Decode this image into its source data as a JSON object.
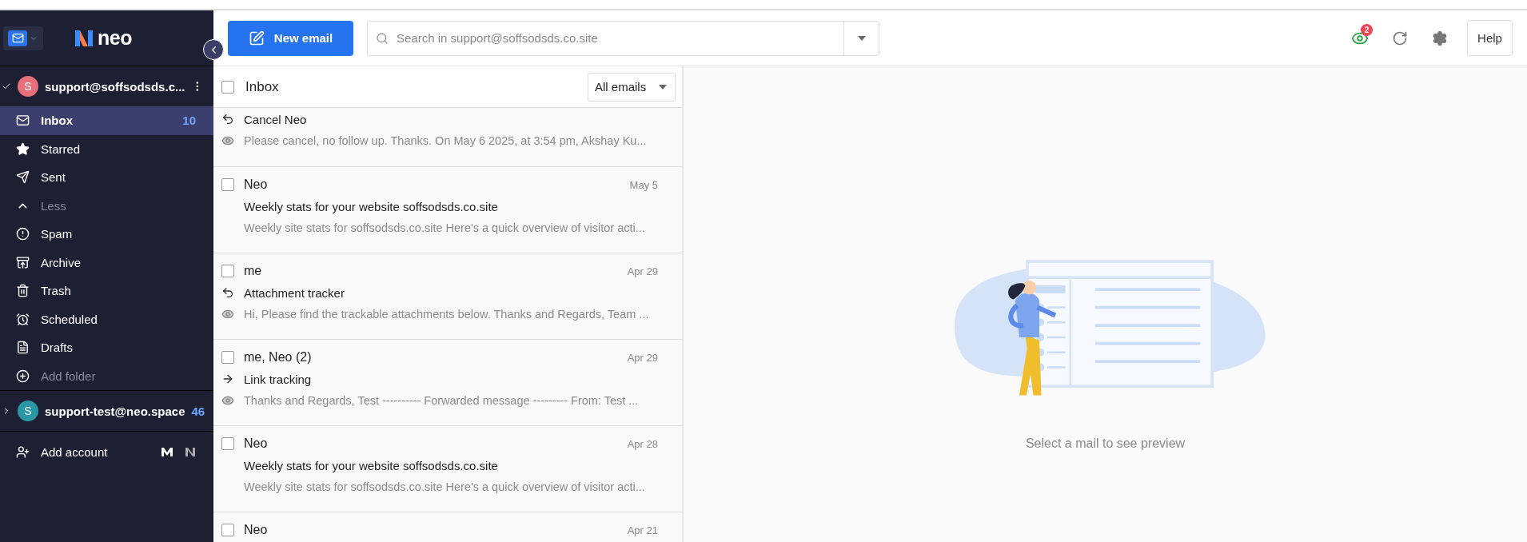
{
  "sidebar": {
    "brand": "neo",
    "accounts": [
      {
        "email": "support@soffsodsds.c...",
        "initial": "S",
        "color": "#e8707d",
        "expanded": true,
        "folders": [
          {
            "kind": "folder",
            "label": "Inbox",
            "count": "10",
            "selected": true
          },
          {
            "kind": "folder",
            "label": "Starred",
            "selected": false
          },
          {
            "kind": "folder",
            "label": "Sent",
            "selected": false
          },
          {
            "kind": "toggle",
            "label": "Less",
            "selected": false
          },
          {
            "kind": "folder",
            "label": "Spam",
            "selected": false
          },
          {
            "kind": "folder",
            "label": "Archive",
            "selected": false
          },
          {
            "kind": "folder",
            "label": "Trash",
            "selected": false
          },
          {
            "kind": "folder",
            "label": "Scheduled",
            "selected": false
          },
          {
            "kind": "folder",
            "label": "Drafts",
            "selected": false
          },
          {
            "kind": "action",
            "label": "Add folder",
            "selected": false
          }
        ]
      },
      {
        "email": "support-test@neo.space",
        "initial": "S",
        "color": "#2a98a4",
        "expanded": false,
        "count": "46"
      }
    ],
    "add_account": "Add account"
  },
  "toolbar": {
    "new_email": "New email",
    "search": {
      "placeholder": "Search in support@soffsodsds.co.site"
    },
    "tracking_badge": "2",
    "help": "Help"
  },
  "mail_list": {
    "title": "Inbox",
    "checked": false,
    "filter": "All emails",
    "rows": [
      {
        "subject": "Cancel Neo",
        "preview": "Please cancel, no follow up. Thanks. On May 6 2025, at 3:54 pm, Akshay Ku...",
        "replied": true,
        "forwarded": false,
        "tracked": true
      },
      {
        "sender": "Neo",
        "date": "May 5",
        "subject": "Weekly stats for your website soffsodsds.co.site",
        "preview": "Weekly site stats for soffsodsds.co.site Here's a quick overview of visitor acti...",
        "replied": false,
        "forwarded": false,
        "tracked": false,
        "checked": false
      },
      {
        "sender": "me",
        "date": "Apr 29",
        "subject": "Attachment tracker",
        "preview": "Hi, Please find the trackable attachments below. Thanks and Regards, Team ...",
        "replied": true,
        "forwarded": false,
        "tracked": true,
        "checked": false
      },
      {
        "sender": "me, Neo (2)",
        "date": "Apr 29",
        "subject": "Link tracking",
        "preview": "Thanks and Regards, Test ---------- Forwarded message --------- From: Test ...",
        "replied": false,
        "forwarded": true,
        "tracked": true,
        "checked": false
      },
      {
        "sender": "Neo",
        "date": "Apr 28",
        "subject": "Weekly stats for your website soffsodsds.co.site",
        "preview": "Weekly site stats for soffsodsds.co.site Here's a quick overview of visitor acti...",
        "replied": false,
        "forwarded": false,
        "tracked": false,
        "checked": false
      },
      {
        "sender": "Neo",
        "date": "Apr 21",
        "checked": false
      }
    ]
  },
  "preview": {
    "message": "Select a mail to see preview"
  }
}
